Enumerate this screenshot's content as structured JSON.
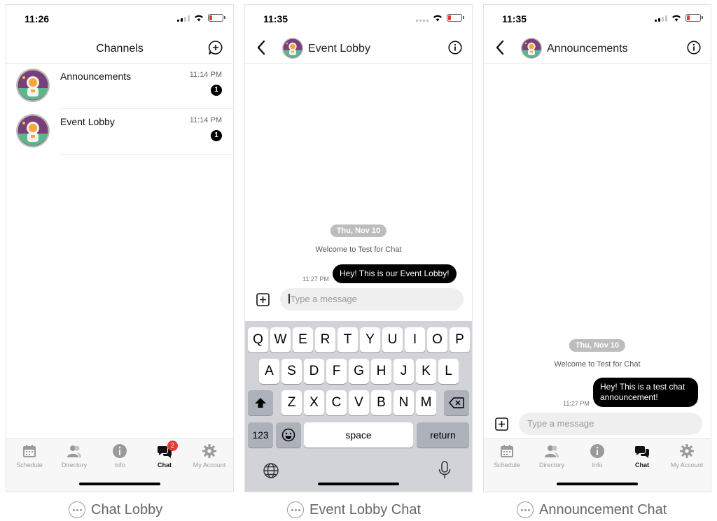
{
  "screens": [
    {
      "status_time": "11:26",
      "title": "Channels",
      "channels": [
        {
          "name": "Announcements",
          "time": "11:14 PM",
          "unread": "1"
        },
        {
          "name": "Event Lobby",
          "time": "11:14 PM",
          "unread": "1"
        }
      ],
      "caption": "Chat Lobby"
    },
    {
      "status_time": "11:35",
      "title": "Event Lobby",
      "date_pill": "Thu, Nov 10",
      "system_message": "Welcome to Test for Chat",
      "message": {
        "time": "11:27 PM",
        "text": "Hey! This is our Event Lobby!"
      },
      "input_placeholder": "Type a message",
      "keyboard": {
        "row1": [
          "Q",
          "W",
          "E",
          "R",
          "T",
          "Y",
          "U",
          "I",
          "O",
          "P"
        ],
        "row2": [
          "A",
          "S",
          "D",
          "F",
          "G",
          "H",
          "J",
          "K",
          "L"
        ],
        "row3": [
          "Z",
          "X",
          "C",
          "V",
          "B",
          "N",
          "M"
        ],
        "numbers_key": "123",
        "space_key": "space",
        "return_key": "return"
      },
      "caption": "Event Lobby Chat"
    },
    {
      "status_time": "11:35",
      "title": "Announcements",
      "date_pill": "Thu, Nov 10",
      "system_message": "Welcome to Test for Chat",
      "message": {
        "time": "11:27 PM",
        "line1": "Hey! This is a test chat",
        "line2": "announcement!"
      },
      "input_placeholder": "Type a message",
      "caption": "Announcement Chat"
    }
  ],
  "tabs": [
    {
      "label": "Schedule",
      "icon": "calendar-icon"
    },
    {
      "label": "Directory",
      "icon": "people-icon"
    },
    {
      "label": "Info",
      "icon": "info-icon"
    },
    {
      "label": "Chat",
      "icon": "chat-icon",
      "badge": "2"
    },
    {
      "label": "My Account",
      "icon": "gear-icon"
    }
  ],
  "colors": {
    "accent": "#000000",
    "badge_red": "#e53935",
    "date_pill": "#bdbdbd",
    "keyboard_bg": "#d1d3d9"
  }
}
